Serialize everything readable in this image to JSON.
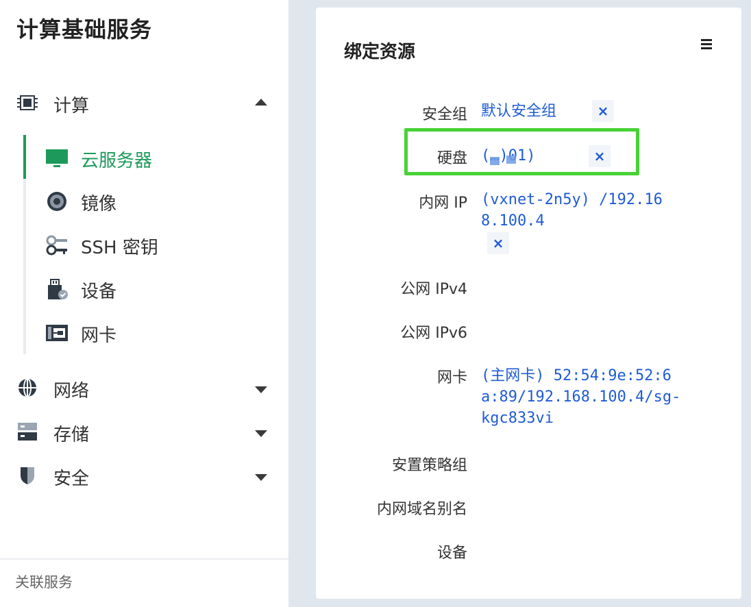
{
  "sidebar": {
    "title": "计算基础服务",
    "groups": [
      {
        "label": "计算",
        "icon": "cpu-chip-icon",
        "expanded": true
      },
      {
        "label": "网络",
        "icon": "globe-icon",
        "expanded": false
      },
      {
        "label": "存储",
        "icon": "storage-icon",
        "expanded": false
      },
      {
        "label": "安全",
        "icon": "shield-icon",
        "expanded": false
      }
    ],
    "compute_items": [
      {
        "label": "云服务器",
        "icon": "monitor-icon",
        "active": true
      },
      {
        "label": "镜像",
        "icon": "disc-icon"
      },
      {
        "label": "SSH 密钥",
        "icon": "key-icon"
      },
      {
        "label": "设备",
        "icon": "usb-device-icon"
      },
      {
        "label": "网卡",
        "icon": "nic-icon"
      }
    ],
    "footer": "关联服务"
  },
  "panel": {
    "title": "绑定资源",
    "rows": [
      {
        "label": "安全组",
        "value": "默认安全组",
        "removable": true
      },
      {
        "label": "硬盘",
        "value": "(…)01)",
        "removable": true,
        "highlighted": true
      },
      {
        "label": "内网 IP",
        "value": "(vxnet-2n5y) /192.168.100.4",
        "removable": true
      },
      {
        "label": "公网 IPv4",
        "value": ""
      },
      {
        "label": "公网 IPv6",
        "value": ""
      },
      {
        "label": "网卡",
        "value": "(主网卡) 52:54:9e:52:6a:89/192.168.100.4/sg-kgc833vi"
      },
      {
        "label": "安置策略组",
        "value": ""
      },
      {
        "label": "内网域名别名",
        "value": ""
      },
      {
        "label": "设备",
        "value": ""
      }
    ],
    "remove_glyph": "×"
  },
  "colors": {
    "accent_green": "#1d9a5b",
    "link_blue": "#1f5bd6",
    "highlight_green": "#48d236",
    "background": "#dfe6ee"
  }
}
